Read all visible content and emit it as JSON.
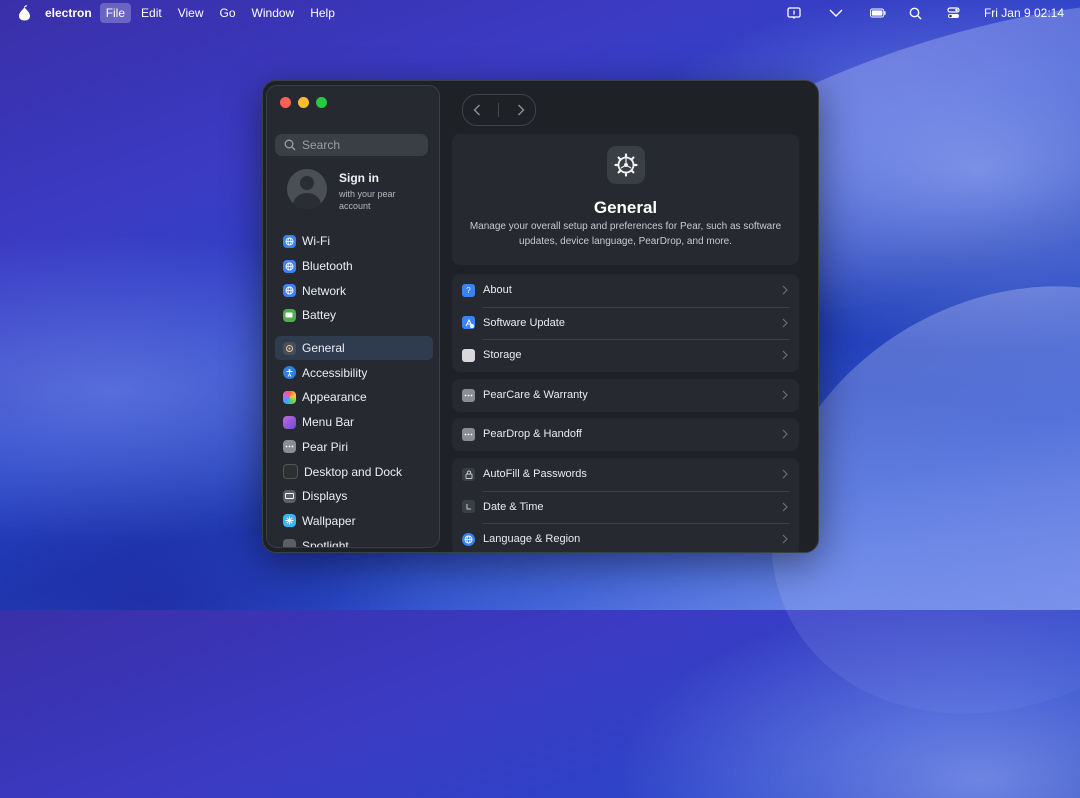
{
  "menubar": {
    "app_name": "electron",
    "items": [
      "File",
      "Edit",
      "View",
      "Go",
      "Window",
      "Help"
    ],
    "active_item": "File",
    "clock": "Fri Jan 9  02:14",
    "status_icons": [
      "message-icon",
      "chevron-down-icon",
      "battery-icon",
      "search-icon",
      "control-center-icon"
    ]
  },
  "sidebar": {
    "search_placeholder": "Search",
    "signin": {
      "title": "Sign in",
      "subtitle": "with your pear account"
    },
    "items": [
      {
        "label": "Wi-Fi",
        "icon": "wifi-icon",
        "color": "#3b82f6"
      },
      {
        "label": "Bluetooth",
        "icon": "bluetooth-icon",
        "color": "#3b82f6"
      },
      {
        "label": "Network",
        "icon": "network-icon",
        "color": "#3b82f6"
      },
      {
        "label": "Battey",
        "icon": "battery-icon",
        "color": "#4caf50"
      },
      {
        "label": "General",
        "icon": "gear-icon",
        "color": "#4a4e55",
        "selected": true
      },
      {
        "label": "Accessibility",
        "icon": "accessibility-icon",
        "color": "#2f7fe6"
      },
      {
        "label": "Appearance",
        "icon": "appearance-icon",
        "color": "#e0e0e0"
      },
      {
        "label": "Menu Bar",
        "icon": "menu-bar-icon",
        "color": "#8e5bd6"
      },
      {
        "label": "Pear Piri",
        "icon": "piri-icon",
        "color": "#8a8d93"
      },
      {
        "label": "Desktop and Dock",
        "icon": "dock-icon",
        "color": "#2c2f34"
      },
      {
        "label": "Displays",
        "icon": "display-icon",
        "color": "#5a5e65"
      },
      {
        "label": "Wallpaper",
        "icon": "wallpaper-icon",
        "color": "#3ab4f2"
      },
      {
        "label": "Spotlight",
        "icon": "spotlight-icon",
        "color": "#5a5e65"
      }
    ]
  },
  "content": {
    "title": "General",
    "description": "Manage your overall setup and preferences for Pear, such as software updates, device language, PearDrop, and more.",
    "groups": [
      [
        {
          "label": "About",
          "icon": "about-icon",
          "color": "#3b82f6"
        },
        {
          "label": "Software Update",
          "icon": "software-update-icon",
          "color": "#3b82f6"
        },
        {
          "label": "Storage",
          "icon": "storage-icon",
          "color": "#d8d8da"
        }
      ],
      [
        {
          "label": "PearCare & Warranty",
          "icon": "pearcare-icon",
          "color": "#8a8d93"
        }
      ],
      [
        {
          "label": "PearDrop & Handoff",
          "icon": "peardrop-icon",
          "color": "#8a8d93"
        }
      ],
      [
        {
          "label": "AutoFill & Passwords",
          "icon": "lock-icon",
          "color": "#3a3e45"
        },
        {
          "label": "Date & Time",
          "icon": "clock-icon",
          "color": "#3a3e45"
        },
        {
          "label": "Language & Region",
          "icon": "globe-icon",
          "color": "#3b82f6"
        }
      ]
    ]
  },
  "colors": {
    "traffic_close": "#fe5f57",
    "traffic_minimize": "#febc2e",
    "traffic_zoom": "#28c840",
    "selection": "#2f3b4f"
  }
}
